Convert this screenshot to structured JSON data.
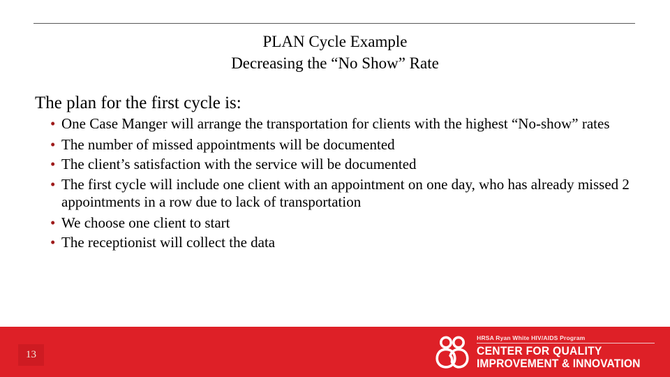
{
  "slide": {
    "page_number": "13",
    "accent_red": "#DE2027",
    "page_box_red": "#CE1B22",
    "bullet_red": "#9E1B1B",
    "rule_color": "#595959"
  },
  "title": {
    "line1": "PLAN Cycle Example",
    "line2": "Decreasing the “No Show” Rate"
  },
  "content": {
    "lead_in": "The plan for the first cycle is:",
    "bullet_glyph": "•",
    "bullets": [
      "One Case Manger will arrange the transportation for clients with the highest “No-show” rates",
      "The number of missed appointments will be documented",
      "The client’s satisfaction with the service will be documented",
      "The first cycle will include one client with an appointment on one day, who has already missed 2 appointments in a row due to lack of transportation",
      "We choose one client to start",
      "The receptionist will collect the data"
    ]
  },
  "logo": {
    "tagline": "HRSA Ryan White HIV/AIDS Program",
    "name_line1": "CENTER FOR QUALITY",
    "name_line2": "IMPROVEMENT & INNOVATION",
    "mark": "two-figures-icon"
  }
}
